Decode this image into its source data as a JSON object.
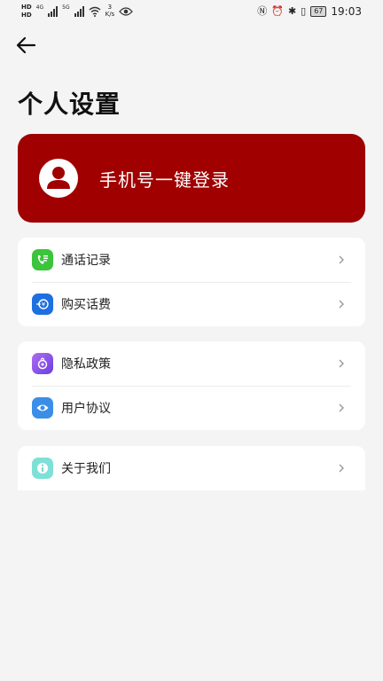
{
  "status_bar": {
    "hd_top": "HD",
    "hd_bottom": "HD",
    "net_4g": "4G",
    "net_5g": "5G",
    "speed_value": "3",
    "speed_unit": "K/s",
    "battery": "67",
    "time": "19:03"
  },
  "page": {
    "title": "个人设置"
  },
  "login": {
    "label": "手机号一键登录"
  },
  "groups": [
    {
      "items": [
        {
          "label": "通话记录",
          "icon": "call-log-icon",
          "color": "#3cc43c"
        },
        {
          "label": "购买话费",
          "icon": "recharge-icon",
          "color": "#1e6fe0"
        }
      ]
    },
    {
      "items": [
        {
          "label": "隐私政策",
          "icon": "privacy-icon",
          "color": "#8a54e8"
        },
        {
          "label": "用户协议",
          "icon": "user-agreement-icon",
          "color": "#3b8ee8"
        }
      ]
    },
    {
      "items": [
        {
          "label": "关于我们",
          "icon": "about-icon",
          "color": "#4fd1c5"
        }
      ]
    }
  ],
  "colors": {
    "accent": "#a00000",
    "background": "#f4f4f5"
  }
}
